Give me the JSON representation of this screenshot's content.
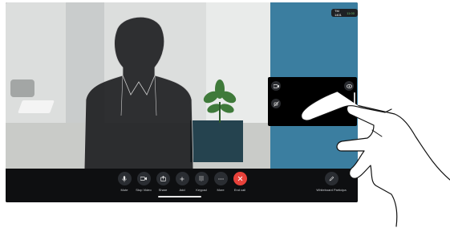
{
  "call_badge": {
    "name": "TM 1401",
    "time": "11:00"
  },
  "selfview": {
    "icons": [
      "camera-switch-icon",
      "eye-icon",
      "mute-camera-icon"
    ]
  },
  "controls": [
    {
      "name": "mute-button",
      "label": "Mute",
      "icon": "microphone-icon"
    },
    {
      "name": "stop-video-button",
      "label": "Stop Video",
      "icon": "video-camera-icon"
    },
    {
      "name": "share-button",
      "label": "Share",
      "icon": "share-icon"
    },
    {
      "name": "add-button",
      "label": "Add",
      "icon": "plus-icon"
    },
    {
      "name": "keypad-button",
      "label": "Keypad",
      "icon": "keypad-icon"
    },
    {
      "name": "more-button",
      "label": "More",
      "icon": "ellipsis-icon"
    },
    {
      "name": "end-call-button",
      "label": "End call",
      "icon": "hangup-icon"
    },
    {
      "name": "whiteboard-button",
      "label": "Whiteboard Participa",
      "icon": "pen-icon"
    }
  ],
  "colors": {
    "end_call": "#e8413a",
    "wall_accent": "#3b7ea0"
  }
}
